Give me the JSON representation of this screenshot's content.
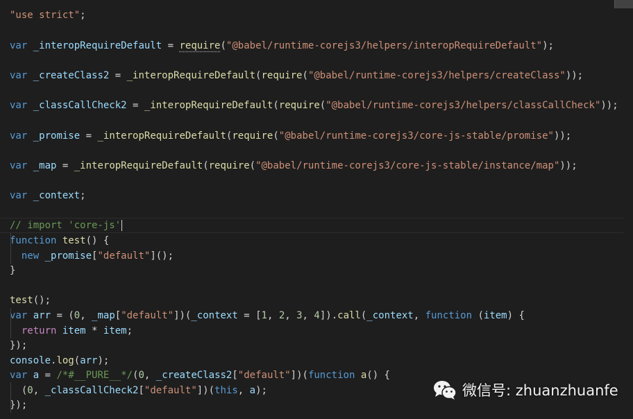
{
  "editor": {
    "lines": [
      [
        {
          "t": "\"use strict\"",
          "c": "string"
        },
        {
          "t": ";",
          "c": "punct"
        }
      ],
      [
        {
          "t": "var",
          "c": "keyword"
        },
        {
          "t": " ",
          "c": "punct"
        },
        {
          "t": "_interopRequireDefault",
          "c": "variable"
        },
        {
          "t": " = ",
          "c": "punct"
        },
        {
          "t": "require",
          "c": "function",
          "u": true
        },
        {
          "t": "(",
          "c": "punct"
        },
        {
          "t": "\"@babel/runtime-corejs3/helpers/interopRequireDefault\"",
          "c": "string"
        },
        {
          "t": ");",
          "c": "punct"
        }
      ],
      [
        {
          "t": "var",
          "c": "keyword"
        },
        {
          "t": " ",
          "c": "punct"
        },
        {
          "t": "_createClass2",
          "c": "variable"
        },
        {
          "t": " = ",
          "c": "punct"
        },
        {
          "t": "_interopRequireDefault",
          "c": "function"
        },
        {
          "t": "(",
          "c": "punct"
        },
        {
          "t": "require",
          "c": "function"
        },
        {
          "t": "(",
          "c": "punct"
        },
        {
          "t": "\"@babel/runtime-corejs3/helpers/createClass\"",
          "c": "string"
        },
        {
          "t": "));",
          "c": "punct"
        }
      ],
      [
        {
          "t": "var",
          "c": "keyword"
        },
        {
          "t": " ",
          "c": "punct"
        },
        {
          "t": "_classCallCheck2",
          "c": "variable"
        },
        {
          "t": " = ",
          "c": "punct"
        },
        {
          "t": "_interopRequireDefault",
          "c": "function"
        },
        {
          "t": "(",
          "c": "punct"
        },
        {
          "t": "require",
          "c": "function"
        },
        {
          "t": "(",
          "c": "punct"
        },
        {
          "t": "\"@babel/runtime-corejs3/helpers/classCallCheck\"",
          "c": "string"
        },
        {
          "t": "));",
          "c": "punct"
        }
      ],
      [
        {
          "t": "var",
          "c": "keyword"
        },
        {
          "t": " ",
          "c": "punct"
        },
        {
          "t": "_promise",
          "c": "variable"
        },
        {
          "t": " = ",
          "c": "punct"
        },
        {
          "t": "_interopRequireDefault",
          "c": "function"
        },
        {
          "t": "(",
          "c": "punct"
        },
        {
          "t": "require",
          "c": "function"
        },
        {
          "t": "(",
          "c": "punct"
        },
        {
          "t": "\"@babel/runtime-corejs3/core-js-stable/promise\"",
          "c": "string"
        },
        {
          "t": "));",
          "c": "punct"
        }
      ],
      [
        {
          "t": "var",
          "c": "keyword"
        },
        {
          "t": " ",
          "c": "punct"
        },
        {
          "t": "_map",
          "c": "variable"
        },
        {
          "t": " = ",
          "c": "punct"
        },
        {
          "t": "_interopRequireDefault",
          "c": "function"
        },
        {
          "t": "(",
          "c": "punct"
        },
        {
          "t": "require",
          "c": "function"
        },
        {
          "t": "(",
          "c": "punct"
        },
        {
          "t": "\"@babel/runtime-corejs3/core-js-stable/instance/map\"",
          "c": "string"
        },
        {
          "t": "));",
          "c": "punct"
        }
      ],
      [
        {
          "t": "var",
          "c": "keyword"
        },
        {
          "t": " ",
          "c": "punct"
        },
        {
          "t": "_context",
          "c": "variable"
        },
        {
          "t": ";",
          "c": "punct"
        }
      ],
      [
        {
          "t": "// import 'core-js'",
          "c": "comment"
        }
      ],
      [
        {
          "t": "function",
          "c": "keyword"
        },
        {
          "t": " ",
          "c": "punct"
        },
        {
          "t": "test",
          "c": "function"
        },
        {
          "t": "() {",
          "c": "punct"
        }
      ],
      [
        {
          "t": "  ",
          "c": "punct"
        },
        {
          "t": "new",
          "c": "keyword"
        },
        {
          "t": " ",
          "c": "punct"
        },
        {
          "t": "_promise",
          "c": "variable"
        },
        {
          "t": "[",
          "c": "punct"
        },
        {
          "t": "\"default\"",
          "c": "string"
        },
        {
          "t": "]();",
          "c": "punct"
        }
      ],
      [
        {
          "t": "}",
          "c": "punct"
        }
      ],
      [
        {
          "t": "test",
          "c": "function"
        },
        {
          "t": "();",
          "c": "punct"
        }
      ],
      [
        {
          "t": "var",
          "c": "keyword"
        },
        {
          "t": " ",
          "c": "punct"
        },
        {
          "t": "arr",
          "c": "variable"
        },
        {
          "t": " = (",
          "c": "punct"
        },
        {
          "t": "0",
          "c": "number"
        },
        {
          "t": ", ",
          "c": "punct"
        },
        {
          "t": "_map",
          "c": "variable"
        },
        {
          "t": "[",
          "c": "punct"
        },
        {
          "t": "\"default\"",
          "c": "string"
        },
        {
          "t": "])(",
          "c": "punct"
        },
        {
          "t": "_context",
          "c": "variable"
        },
        {
          "t": " = [",
          "c": "punct"
        },
        {
          "t": "1",
          "c": "number"
        },
        {
          "t": ", ",
          "c": "punct"
        },
        {
          "t": "2",
          "c": "number"
        },
        {
          "t": ", ",
          "c": "punct"
        },
        {
          "t": "3",
          "c": "number"
        },
        {
          "t": ", ",
          "c": "punct"
        },
        {
          "t": "4",
          "c": "number"
        },
        {
          "t": "]).",
          "c": "punct"
        },
        {
          "t": "call",
          "c": "function"
        },
        {
          "t": "(",
          "c": "punct"
        },
        {
          "t": "_context",
          "c": "variable"
        },
        {
          "t": ", ",
          "c": "punct"
        },
        {
          "t": "function",
          "c": "keyword"
        },
        {
          "t": " (",
          "c": "punct"
        },
        {
          "t": "item",
          "c": "variable"
        },
        {
          "t": ") {",
          "c": "punct"
        }
      ],
      [
        {
          "t": "  ",
          "c": "punct"
        },
        {
          "t": "return",
          "c": "control"
        },
        {
          "t": " ",
          "c": "punct"
        },
        {
          "t": "item",
          "c": "variable"
        },
        {
          "t": " * ",
          "c": "punct"
        },
        {
          "t": "item",
          "c": "variable"
        },
        {
          "t": ";",
          "c": "punct"
        }
      ],
      [
        {
          "t": "});",
          "c": "punct"
        }
      ],
      [
        {
          "t": "console",
          "c": "variable"
        },
        {
          "t": ".",
          "c": "punct"
        },
        {
          "t": "log",
          "c": "function"
        },
        {
          "t": "(",
          "c": "punct"
        },
        {
          "t": "arr",
          "c": "variable"
        },
        {
          "t": ");",
          "c": "punct"
        }
      ],
      [
        {
          "t": "var",
          "c": "keyword"
        },
        {
          "t": " ",
          "c": "punct"
        },
        {
          "t": "a",
          "c": "variable"
        },
        {
          "t": " = ",
          "c": "punct"
        },
        {
          "t": "/*#__PURE__*/",
          "c": "comment"
        },
        {
          "t": "(",
          "c": "punct"
        },
        {
          "t": "0",
          "c": "number"
        },
        {
          "t": ", ",
          "c": "punct"
        },
        {
          "t": "_createClass2",
          "c": "variable"
        },
        {
          "t": "[",
          "c": "punct"
        },
        {
          "t": "\"default\"",
          "c": "string"
        },
        {
          "t": "])(",
          "c": "punct"
        },
        {
          "t": "function",
          "c": "keyword"
        },
        {
          "t": " ",
          "c": "punct"
        },
        {
          "t": "a",
          "c": "function"
        },
        {
          "t": "() {",
          "c": "punct"
        }
      ],
      [
        {
          "t": "  (",
          "c": "punct"
        },
        {
          "t": "0",
          "c": "number"
        },
        {
          "t": ", ",
          "c": "punct"
        },
        {
          "t": "_classCallCheck2",
          "c": "variable"
        },
        {
          "t": "[",
          "c": "punct"
        },
        {
          "t": "\"default\"",
          "c": "string"
        },
        {
          "t": "])(",
          "c": "punct"
        },
        {
          "t": "this",
          "c": "keyword"
        },
        {
          "t": ", ",
          "c": "punct"
        },
        {
          "t": "a",
          "c": "variable"
        },
        {
          "t": ");",
          "c": "punct"
        }
      ],
      [
        {
          "t": "});",
          "c": "punct"
        }
      ]
    ],
    "colors": {
      "background": "#1e1e1e",
      "keyword": "#569cd6",
      "control": "#c586c0",
      "variable": "#9cdcfe",
      "function": "#dcdcaa",
      "string": "#ce9178",
      "number": "#b5cea8",
      "comment": "#6a9955",
      "punct": "#d4d4d4"
    }
  },
  "watermark": {
    "icon": "wechat-icon",
    "text": "微信号: zhuanzhuanfe"
  }
}
